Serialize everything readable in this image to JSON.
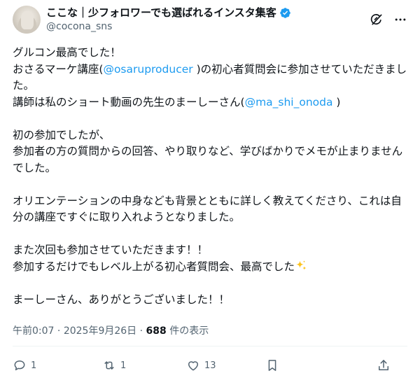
{
  "author": {
    "display_name": "ここな｜少フォロワーでも選ばれるインスタ集客",
    "handle": "@cocona_sns",
    "verified": true,
    "avatar_icon": "avatar-photo"
  },
  "header_icons": [
    "grok-icon",
    "more-icon"
  ],
  "body": {
    "p1": {
      "l1": "グルコン最高でした！",
      "l2_a": "おさるマーケ講座(",
      "l2_mention": "@osaruproducer",
      "l2_b": " )の初心者質問会に参加させていただきました。",
      "l3_a": "講師は私のショート動画の先生のまーしーさん(",
      "l3_mention": "@ma_shi_onoda",
      "l3_b": " )"
    },
    "p2": "初の参加でしたが、\n参加者の方の質問からの回答、やり取りなど、学びばかりでメモが止まりませんでした。",
    "p3": "オリエンテーションの中身なども背景とともに詳しく教えてくださり、これは自分の講座ですぐに取り入れようとなりました。",
    "p4": {
      "l1": "また次回も参加させていただきます！！",
      "l2": "参加するだけでもレベル上がる初心者質問会、最高でした"
    },
    "p5": "まーしーさん、ありがとうございました！！",
    "emoji": "sparkles-icon"
  },
  "meta": {
    "time": "午前0:07",
    "sep1": " · ",
    "date": "2025年9月26日",
    "sep2": " · ",
    "views_count": "688",
    "views_label": " 件の表示"
  },
  "actions": {
    "reply_count": "1",
    "retweet_count": "1",
    "like_count": "13"
  },
  "colors": {
    "accent": "#1d9bf0",
    "text": "#0f1419",
    "muted": "#536471"
  }
}
